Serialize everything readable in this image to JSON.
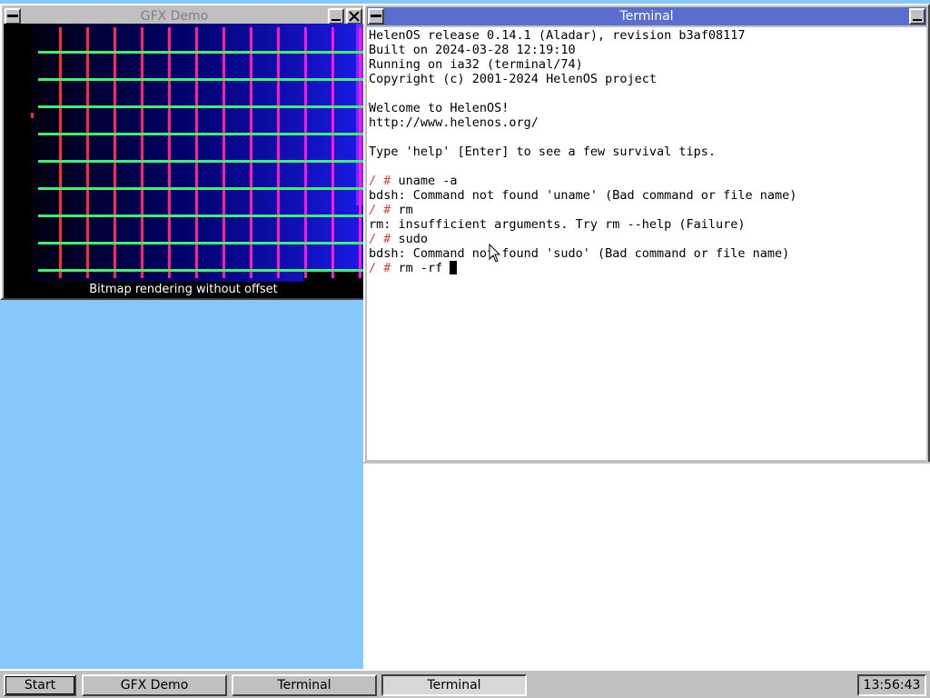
{
  "gfx_window": {
    "title": "GFX Demo",
    "caption": "Bitmap rendering without offset",
    "menu_icon": "window-menu-icon",
    "minimize_icon": "minimize-icon",
    "close_icon": "close-icon"
  },
  "terminal_window": {
    "title": "Terminal",
    "menu_icon": "window-menu-icon",
    "minimize_icon": "minimize-icon",
    "lines": [
      {
        "prompt": "",
        "text": "HelenOS release 0.14.1 (Aladar), revision b3af08117"
      },
      {
        "prompt": "",
        "text": "Built on 2024-03-28 12:19:10"
      },
      {
        "prompt": "",
        "text": "Running on ia32 (terminal/74)"
      },
      {
        "prompt": "",
        "text": "Copyright (c) 2001-2024 HelenOS project"
      },
      {
        "prompt": "",
        "text": ""
      },
      {
        "prompt": "",
        "text": "Welcome to HelenOS!"
      },
      {
        "prompt": "",
        "text": "http://www.helenos.org/"
      },
      {
        "prompt": "",
        "text": ""
      },
      {
        "prompt": "",
        "text": "Type 'help' [Enter] to see a few survival tips."
      },
      {
        "prompt": "",
        "text": ""
      },
      {
        "prompt": "/ # ",
        "text": "uname -a"
      },
      {
        "prompt": "",
        "text": "bdsh: Command not found 'uname' (Bad command or file name)"
      },
      {
        "prompt": "/ # ",
        "text": "rm"
      },
      {
        "prompt": "",
        "text": "rm: insufficient arguments. Try rm --help (Failure)"
      },
      {
        "prompt": "/ # ",
        "text": "sudo"
      },
      {
        "prompt": "",
        "text": "bdsh: Command not found 'sudo' (Bad command or file name)"
      },
      {
        "prompt": "/ # ",
        "text": "rm -rf "
      }
    ]
  },
  "taskbar": {
    "start_label": "Start",
    "buttons": [
      "GFX Demo",
      "Terminal",
      "Terminal"
    ],
    "clock": "13:56:43"
  },
  "colors": {
    "desktop": "#87c8fb",
    "active_title": "#5a6ed0",
    "prompt": "#d84040"
  }
}
